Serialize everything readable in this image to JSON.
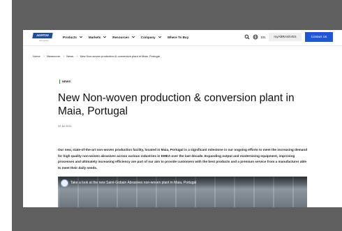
{
  "nav": {
    "logo_text": "NORTON",
    "logo_sub": "saint-gobain",
    "menu": [
      {
        "label": "Products"
      },
      {
        "label": "Markets"
      },
      {
        "label": "Resources"
      },
      {
        "label": "Company"
      },
      {
        "label": "Where To Buy"
      }
    ],
    "lang": "EN",
    "my_button": "myABRASIVES",
    "contact_button": "Contact Us"
  },
  "breadcrumb": {
    "items": [
      "Home",
      "Newsroom",
      "News",
      "New Non-woven production & conversion plant in Maia, Portugal"
    ]
  },
  "article": {
    "badge": "NEWS",
    "title": "New Non-woven production & conversion plant in Maia, Portugal",
    "date": "29 Jul 2021",
    "body": "Our new, state-of-the-art non-woven production facility, located in Maia, Portugal is a significant milestone in our ongoing efforts to meet the increasing demand for high quality non-woven abrasives across various industries in EMEA over the last decade. Expanding output and modernising equipment, improving processes and ultimately increasing efficiency are part of our aim to provide customers with the best products and a premium service from a manufacturer able to meet their daily needs.",
    "video_title": "Take a look at the new Saint-Gobain Abrasives non-woven plant in Maia, Portugal"
  },
  "colors": {
    "brand_blue": "#1f4ea0",
    "contact_blue": "#1e56d6",
    "badge_green": "#2c8a3b"
  }
}
